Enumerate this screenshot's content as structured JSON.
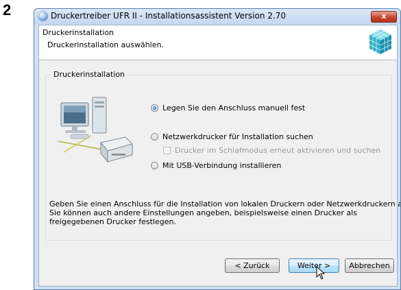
{
  "step_number": "2",
  "window": {
    "title": "Druckertreiber UFR II - Installationsassistent Version 2.70",
    "close_label": "x"
  },
  "header": {
    "title": "Druckerinstallation",
    "subtitle": "Druckerinstallation auswählen."
  },
  "group": {
    "label": "Druckerinstallation",
    "options": [
      {
        "label": "Legen Sie den Anschluss manuell fest",
        "selected": true
      },
      {
        "label": "Netzwerkdrucker für Installation suchen",
        "selected": false
      },
      {
        "label": "Mit USB-Verbindung installieren",
        "selected": false
      }
    ],
    "sleep_checkbox": {
      "label": "Drucker im Schlafmodus erneut aktivieren und suchen",
      "checked": false,
      "enabled": false
    }
  },
  "description": [
    "Geben Sie einen Anschluss für die Installation von lokalen Druckern oder Netzwerkdruckern an.",
    "Sie können auch andere Einstellungen angeben, beispielsweise einen Drucker als",
    "freigegebenen Drucker festlegen."
  ],
  "buttons": {
    "back": "< Zurück",
    "next": "Weiter >",
    "cancel": "Abbrechen"
  },
  "colors": {
    "window_frame": "#cfe0f3",
    "close_button": "#c9462c",
    "logo": "#2fb2c8"
  },
  "icons": {
    "title": "printer-driver-icon",
    "logo": "canon-cube-logo",
    "illustration": "computer-printer-illustration",
    "cursor": "mouse-pointer-icon"
  }
}
